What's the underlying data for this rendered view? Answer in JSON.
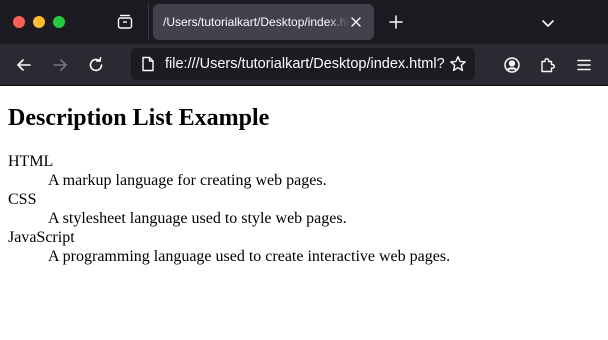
{
  "window": {
    "controls": [
      "close",
      "minimize",
      "zoom"
    ]
  },
  "tabs": [
    {
      "title": "/Users/tutorialkart/Desktop/index.html",
      "active": true
    }
  ],
  "toolbar": {
    "url": "file:///Users/tutorialkart/Desktop/index.html?",
    "icons": [
      "back-icon",
      "forward-icon",
      "reload-icon",
      "page-icon",
      "bookmark-star-icon",
      "account-icon",
      "extensions-icon",
      "menu-icon"
    ]
  },
  "page": {
    "title": "Description List Example",
    "items": [
      {
        "term": "HTML",
        "description": "A markup language for creating web pages."
      },
      {
        "term": "CSS",
        "description": "A stylesheet language used to style web pages."
      },
      {
        "term": "JavaScript",
        "description": "A programming language used to create interactive web pages."
      }
    ]
  },
  "colors": {
    "tabbar": "#1c1b22",
    "toolbar": "#2b2a33",
    "active_tab": "#42414d",
    "urlbar": "#1c1b22",
    "close": "#ff5f57",
    "minimize": "#febc2e",
    "zoom": "#28c840"
  }
}
